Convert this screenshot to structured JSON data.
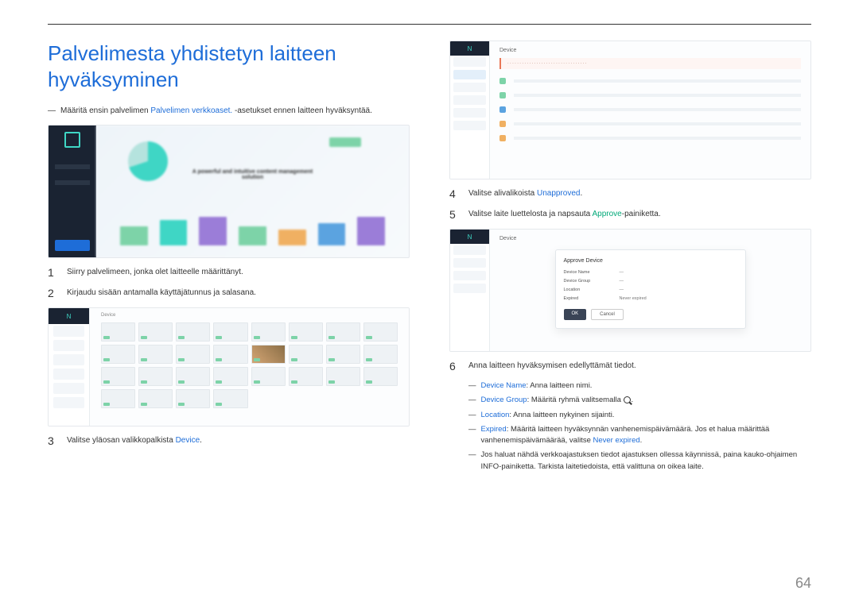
{
  "title": "Palvelimesta yhdistetyn laitteen hyväksyminen",
  "intro": {
    "prefix": "Määritä ensin palvelimen ",
    "link": "Palvelimen verkkoaset.",
    "suffix": " -asetukset ennen laitteen hyväksyntää."
  },
  "shot1_text": "A powerful and intuitive content management solution",
  "shot2_header": "Device",
  "shot3_header": "Device",
  "shot4_header": "Device",
  "modal": {
    "title": "Approve Device",
    "f1": "Device Name",
    "f2": "Device Group",
    "f3": "Location",
    "f4": "Expired",
    "f4v": "Never expired",
    "btn_ok": "OK",
    "btn_cancel": "Cancel"
  },
  "steps": {
    "s1": "Siirry palvelimeen, jonka olet laitteelle määrittänyt.",
    "s2": "Kirjaudu sisään antamalla käyttäjätunnus ja salasana.",
    "s3_pre": "Valitse yläosan valikkopalkista ",
    "s3_link": "Device",
    "s3_post": ".",
    "s4_pre": "Valitse alivalikoista ",
    "s4_link": "Unapproved",
    "s4_post": ".",
    "s5_pre": "Valitse laite luettelosta ja napsauta ",
    "s5_link": "Approve",
    "s5_post": "-painiketta.",
    "s6": "Anna laitteen hyväksymisen edellyttämät tiedot."
  },
  "subs": {
    "a_label": "Device Name",
    "a_text": ": Anna laitteen nimi.",
    "b_label": "Device Group",
    "b_text": ": Määritä ryhmä valitsemalla ",
    "b_post": ".",
    "c_label": "Location",
    "c_text": ": Anna laitteen nykyinen sijainti.",
    "d_label": "Expired",
    "d_text": ": Määritä laitteen hyväksynnän vanhenemispäivämäärä. Jos et halua määrittää vanhenemispäivämäärää, valitse ",
    "d_link": "Never expired",
    "d_post": ".",
    "e_text": "Jos haluat nähdä verkkoajastuksen tiedot ajastuksen ollessa käynnissä, paina kauko-ohjaimen INFO-painiketta. Tarkista laitetiedoista, että valittuna on oikea laite."
  },
  "page_number": "64"
}
